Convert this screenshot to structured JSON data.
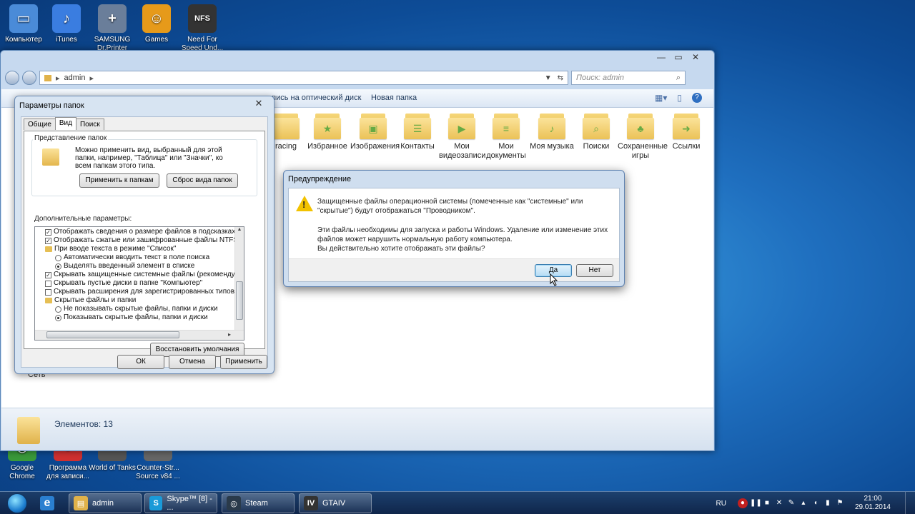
{
  "desktop": {
    "icons_top": [
      {
        "label": "Компьютер",
        "color": "#4a8bd8",
        "glyph": "▭"
      },
      {
        "label": "iTunes",
        "color": "#3a7de0",
        "glyph": "♪"
      },
      {
        "label": "SAMSUNG Dr.Printer",
        "color": "#6a7e9a",
        "glyph": "+"
      },
      {
        "label": "Games",
        "color": "#e69a1a",
        "glyph": "☺"
      },
      {
        "label": "Need For Speed Und...",
        "color": "#333333",
        "glyph": "NFS"
      }
    ],
    "icons_bottom": [
      {
        "label": "Google Chrome",
        "color": "#3a9a3a",
        "glyph": "◉"
      },
      {
        "label": "Программа для записи...",
        "color": "#d03030",
        "glyph": "●"
      },
      {
        "label": "World of Tanks",
        "color": "#555555",
        "glyph": "WoT"
      },
      {
        "label": "Counter-Str... Source v84 ...",
        "color": "#666666",
        "glyph": "CS"
      }
    ]
  },
  "explorer": {
    "breadcrumb": [
      "admin"
    ],
    "search_placeholder": "Поиск: admin",
    "cmd_items": [
      "апись на оптический диск",
      "Новая папка"
    ],
    "folders": [
      {
        "label": "racing",
        "glyph": ""
      },
      {
        "label": "Избранное",
        "glyph": "★"
      },
      {
        "label": "Изображения",
        "glyph": "▣"
      },
      {
        "label": "Контакты",
        "glyph": "☰"
      },
      {
        "label": "Мои видеозаписи",
        "glyph": "▶"
      },
      {
        "label": "Мои документы",
        "glyph": "≡"
      },
      {
        "label": "Моя музыка",
        "glyph": "♪"
      },
      {
        "label": "Поиски",
        "glyph": "⌕"
      },
      {
        "label": "Сохраненные игры",
        "glyph": "♣"
      },
      {
        "label": "Ссылки",
        "glyph": "➜"
      }
    ],
    "nav_network": "Сеть",
    "status": "Элементов: 13"
  },
  "folder_options": {
    "title": "Параметры папок",
    "tabs": [
      "Общие",
      "Вид",
      "Поиск"
    ],
    "active_tab": "Вид",
    "group_title": "Представление папок",
    "group_text": "Можно применить вид, выбранный для этой папки, например, \"Таблица\" или \"Значки\", ко всем папкам этого типа.",
    "apply_to_folders": "Применить к папкам",
    "reset_folders": "Сброс вида папок",
    "advanced_label": "Дополнительные параметры:",
    "items": [
      {
        "type": "check",
        "checked": true,
        "text": "Отображать сведения о размере файлов в подсказках п"
      },
      {
        "type": "check",
        "checked": true,
        "text": "Отображать сжатые или зашифрованные файлы NTFS д"
      },
      {
        "type": "folder",
        "text": "При вводе текста в режиме \"Список\""
      },
      {
        "type": "radio",
        "checked": false,
        "indent": true,
        "text": "Автоматически вводить текст в поле поиска"
      },
      {
        "type": "radio",
        "checked": true,
        "indent": true,
        "text": "Выделять введенный элемент в списке"
      },
      {
        "type": "check",
        "checked": true,
        "text": "Скрывать защищенные системные файлы (рекомендуетс"
      },
      {
        "type": "check",
        "checked": false,
        "text": "Скрывать пустые диски в папке \"Компьютер\""
      },
      {
        "type": "check",
        "checked": false,
        "text": "Скрывать расширения для зарегистрированных типов ф"
      },
      {
        "type": "folder",
        "text": "Скрытые файлы и папки"
      },
      {
        "type": "radio",
        "checked": false,
        "indent": true,
        "text": "Не показывать скрытые файлы, папки и диски"
      },
      {
        "type": "radio",
        "checked": true,
        "indent": true,
        "text": "Показывать скрытые файлы, папки и диски"
      }
    ],
    "restore_defaults": "Восстановить умолчания",
    "ok": "ОК",
    "cancel": "Отмена",
    "apply": "Применить"
  },
  "warning": {
    "title": "Предупреждение",
    "line1": "Защищенные файлы операционной системы (помеченные как \"системные\" или \"скрытые\") будут отображаться \"Проводником\".",
    "line2": "Эти файлы необходимы для запуска и работы Windows. Удаление или изменение этих файлов может нарушить нормальную работу компьютера.",
    "line3": "Вы действительно хотите отображать эти файлы?",
    "yes": "Да",
    "no": "Нет"
  },
  "taskbar": {
    "items": [
      {
        "label": "admin",
        "color": "#e0b24a",
        "glyph": "▤"
      },
      {
        "label": "Skype™ [8] - ...",
        "color": "#1a9ad8",
        "glyph": "S"
      },
      {
        "label": "Steam",
        "color": "#2a3a4a",
        "glyph": "◎"
      },
      {
        "label": "GTAIV",
        "color": "#333333",
        "glyph": "IV"
      }
    ],
    "lang": "RU",
    "time": "21:00",
    "date": "29.01.2014"
  }
}
